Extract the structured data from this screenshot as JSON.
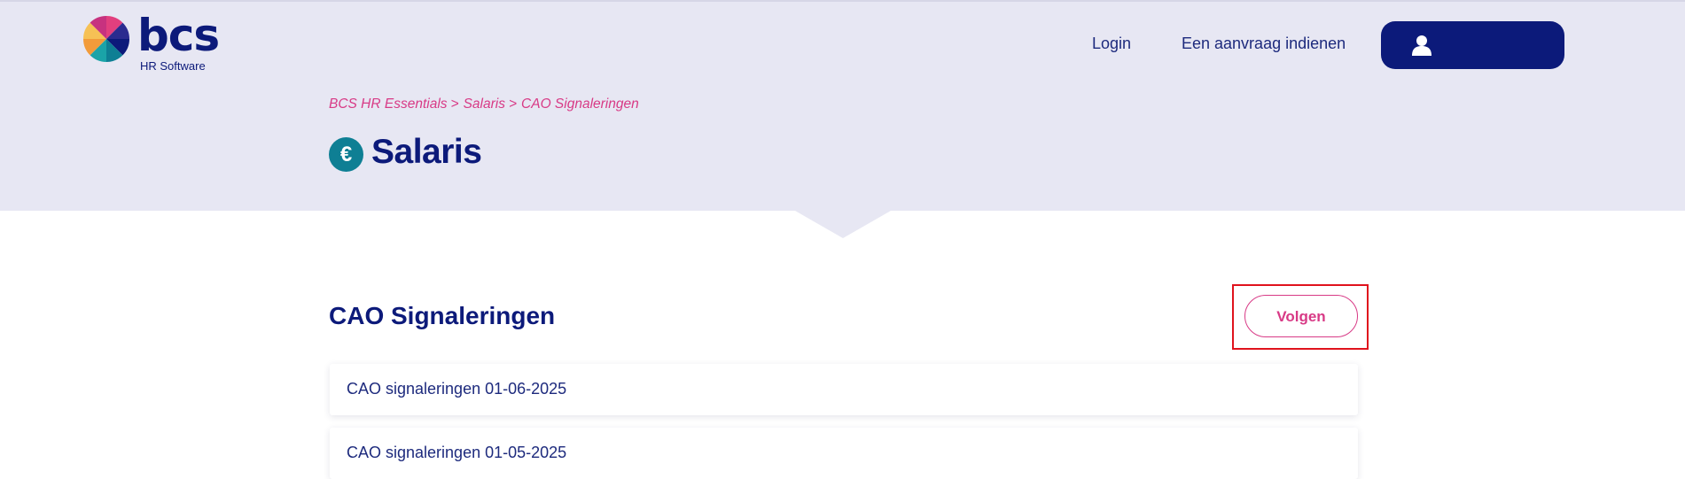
{
  "brand": {
    "name": "bcs",
    "tagline": "HR Software",
    "colors": {
      "navy": "#0c1a7a",
      "pink": "#d83a86",
      "teal": "#0e7f94",
      "header_bg": "#e7e7f3"
    }
  },
  "nav": {
    "login": "Login",
    "request": "Een aanvraag indienen",
    "account_icon": "user-icon"
  },
  "breadcrumb": {
    "items": [
      "BCS HR Essentials",
      "Salaris",
      "CAO Signaleringen"
    ],
    "separator": ">"
  },
  "page": {
    "icon_glyph": "€",
    "title": "Salaris"
  },
  "section": {
    "title": "CAO Signaleringen",
    "follow_label": "Volgen"
  },
  "list": [
    {
      "label": "CAO signaleringen 01-06-2025"
    },
    {
      "label": "CAO signaleringen 01-05-2025"
    }
  ]
}
